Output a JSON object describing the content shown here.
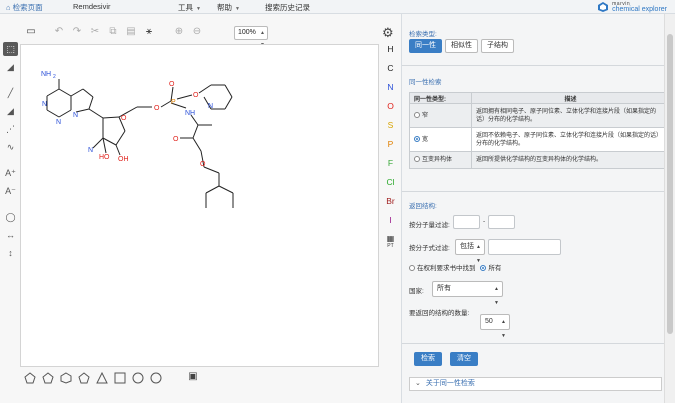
{
  "topbar": {
    "home": "检索页面",
    "title": "Remdesivir",
    "tools_menu": "工具",
    "help_menu": "帮助",
    "history": "搜索历史记录",
    "logo_line1": "marvin",
    "logo_line2": "chemical explorer"
  },
  "editor": {
    "zoom": "100%",
    "elements": [
      "H",
      "C",
      "N",
      "O",
      "S",
      "P",
      "F",
      "Cl",
      "Br",
      "I"
    ],
    "element_colors": [
      "#222222",
      "#222222",
      "#2a4fd8",
      "#e0201a",
      "#d8a400",
      "#e08000",
      "#3aa83a",
      "#2aa82a",
      "#a02020",
      "#9a1a8a"
    ],
    "periodic_table_label": "PT",
    "atoms": {
      "nh2": "NH",
      "nh2_sub": "2",
      "n_list": [
        "N",
        "N",
        "N",
        "N",
        "N"
      ],
      "o_list": [
        "O",
        "O",
        "O",
        "O",
        "O",
        "O"
      ],
      "p": "P",
      "nh": "NH",
      "oh1": "HO",
      "oh2": "OH"
    }
  },
  "panel": {
    "search_type_label": "检索类型:",
    "tabs": [
      "同一性",
      "相似性",
      "子结构"
    ],
    "active_tab": 0,
    "identity_label": "同一性检索",
    "table_headers": [
      "同一性类型:",
      "描述"
    ],
    "rows": [
      {
        "type": "窄",
        "desc": "返回拥有相同电子、原子同位素、立体化学和连接片段（如果指定的话）分布的化学结构。",
        "checked": false
      },
      {
        "type": "宽",
        "desc": "返回不依赖电子、原子同位素、立体化学和连接片段（如果指定的话）分布的化学结构。",
        "checked": true
      },
      {
        "type": "互变异构体",
        "desc": "返回所提供化学结构的互变异构体的化学结构。",
        "checked": false
      }
    ],
    "return_struct_label": "返回结构:",
    "mw_filter_label": "按分子量过滤:",
    "mw_dash": "-",
    "mw_from": "",
    "mw_to": "",
    "formula_filter_label": "按分子式过滤:",
    "formula_mode": "包括",
    "formula_value": "",
    "patent_option": "在权利要求书中找到",
    "all_option": "所有",
    "country_label": "国家:",
    "country_value": "所有",
    "count_label": "要返回的结构的数量:",
    "count_value": "50",
    "search_button": "检索",
    "clear_button": "清空",
    "about_label": "关于同一性检索"
  }
}
